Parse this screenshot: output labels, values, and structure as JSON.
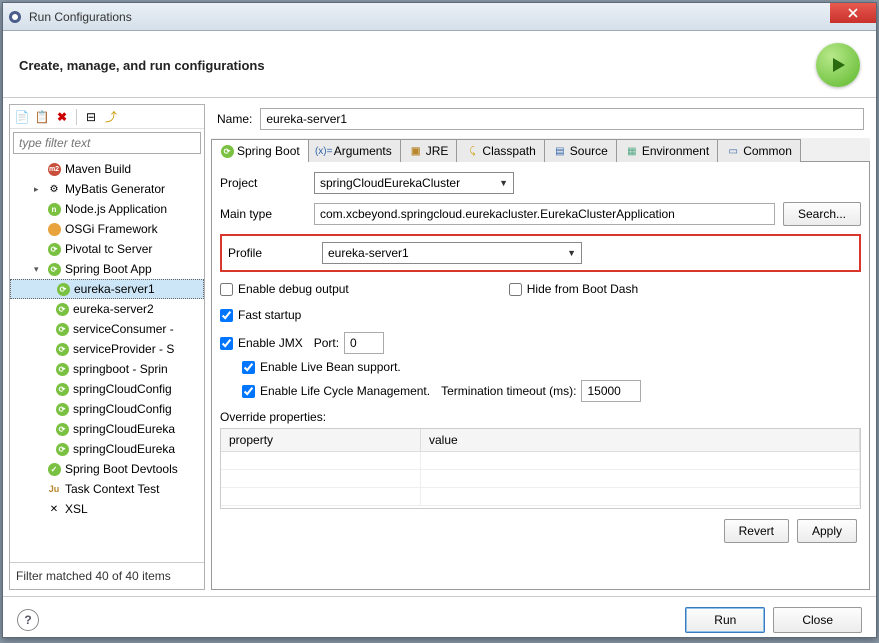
{
  "window": {
    "title": "Run Configurations"
  },
  "header": {
    "title": "Create, manage, and run configurations"
  },
  "toolbar": {
    "new_icon": "new",
    "copy_icon": "copy",
    "delete_icon": "delete",
    "collapse_icon": "collapse",
    "expand_icon": "expand"
  },
  "filter": {
    "placeholder": "type filter text"
  },
  "tree": {
    "items": [
      {
        "label": "Maven Build",
        "icon": "m2"
      },
      {
        "label": "MyBatis Generator",
        "icon": "gear",
        "expander": "▸"
      },
      {
        "label": "Node.js Application",
        "icon": "node"
      },
      {
        "label": "OSGi Framework",
        "icon": "osgi"
      },
      {
        "label": "Pivotal tc Server",
        "icon": "pivotal"
      },
      {
        "label": "Spring Boot App",
        "icon": "spring",
        "expander": "▾",
        "children": [
          {
            "label": "eureka-server1",
            "selected": true
          },
          {
            "label": "eureka-server2"
          },
          {
            "label": "serviceConsumer -"
          },
          {
            "label": "serviceProvider - S"
          },
          {
            "label": "springboot - Sprin"
          },
          {
            "label": "springCloudConfig"
          },
          {
            "label": "springCloudConfig"
          },
          {
            "label": "springCloudEureka"
          },
          {
            "label": "springCloudEureka"
          }
        ]
      },
      {
        "label": "Spring Boot Devtools",
        "icon": "spring-dev"
      },
      {
        "label": "Task Context Test",
        "icon": "ju"
      },
      {
        "label": "XSL",
        "icon": "xsl"
      }
    ]
  },
  "filter_status": "Filter matched 40 of 40 items",
  "name": {
    "label": "Name:",
    "value": "eureka-server1"
  },
  "tabs": [
    {
      "label": "Spring Boot",
      "active": true
    },
    {
      "label": "Arguments"
    },
    {
      "label": "JRE"
    },
    {
      "label": "Classpath"
    },
    {
      "label": "Source"
    },
    {
      "label": "Environment"
    },
    {
      "label": "Common"
    }
  ],
  "form": {
    "project_label": "Project",
    "project_value": "springCloudEurekaCluster",
    "maintype_label": "Main type",
    "maintype_value": "com.xcbeyond.springcloud.eurekacluster.EurekaClusterApplication",
    "search_btn": "Search...",
    "profile_label": "Profile",
    "profile_value": "eureka-server1",
    "enable_debug": "Enable debug output",
    "hide_boot_dash": "Hide from Boot Dash",
    "fast_startup": "Fast startup",
    "enable_jmx": "Enable JMX",
    "port_label": "Port:",
    "port_value": "0",
    "enable_live_bean": "Enable Live Bean support.",
    "enable_lifecycle": "Enable Life Cycle Management.",
    "term_timeout_label": "Termination timeout (ms):",
    "term_timeout_value": "15000",
    "override_label": "Override properties:",
    "col_property": "property",
    "col_value": "value"
  },
  "buttons": {
    "revert": "Revert",
    "apply": "Apply",
    "run": "Run",
    "close": "Close"
  }
}
